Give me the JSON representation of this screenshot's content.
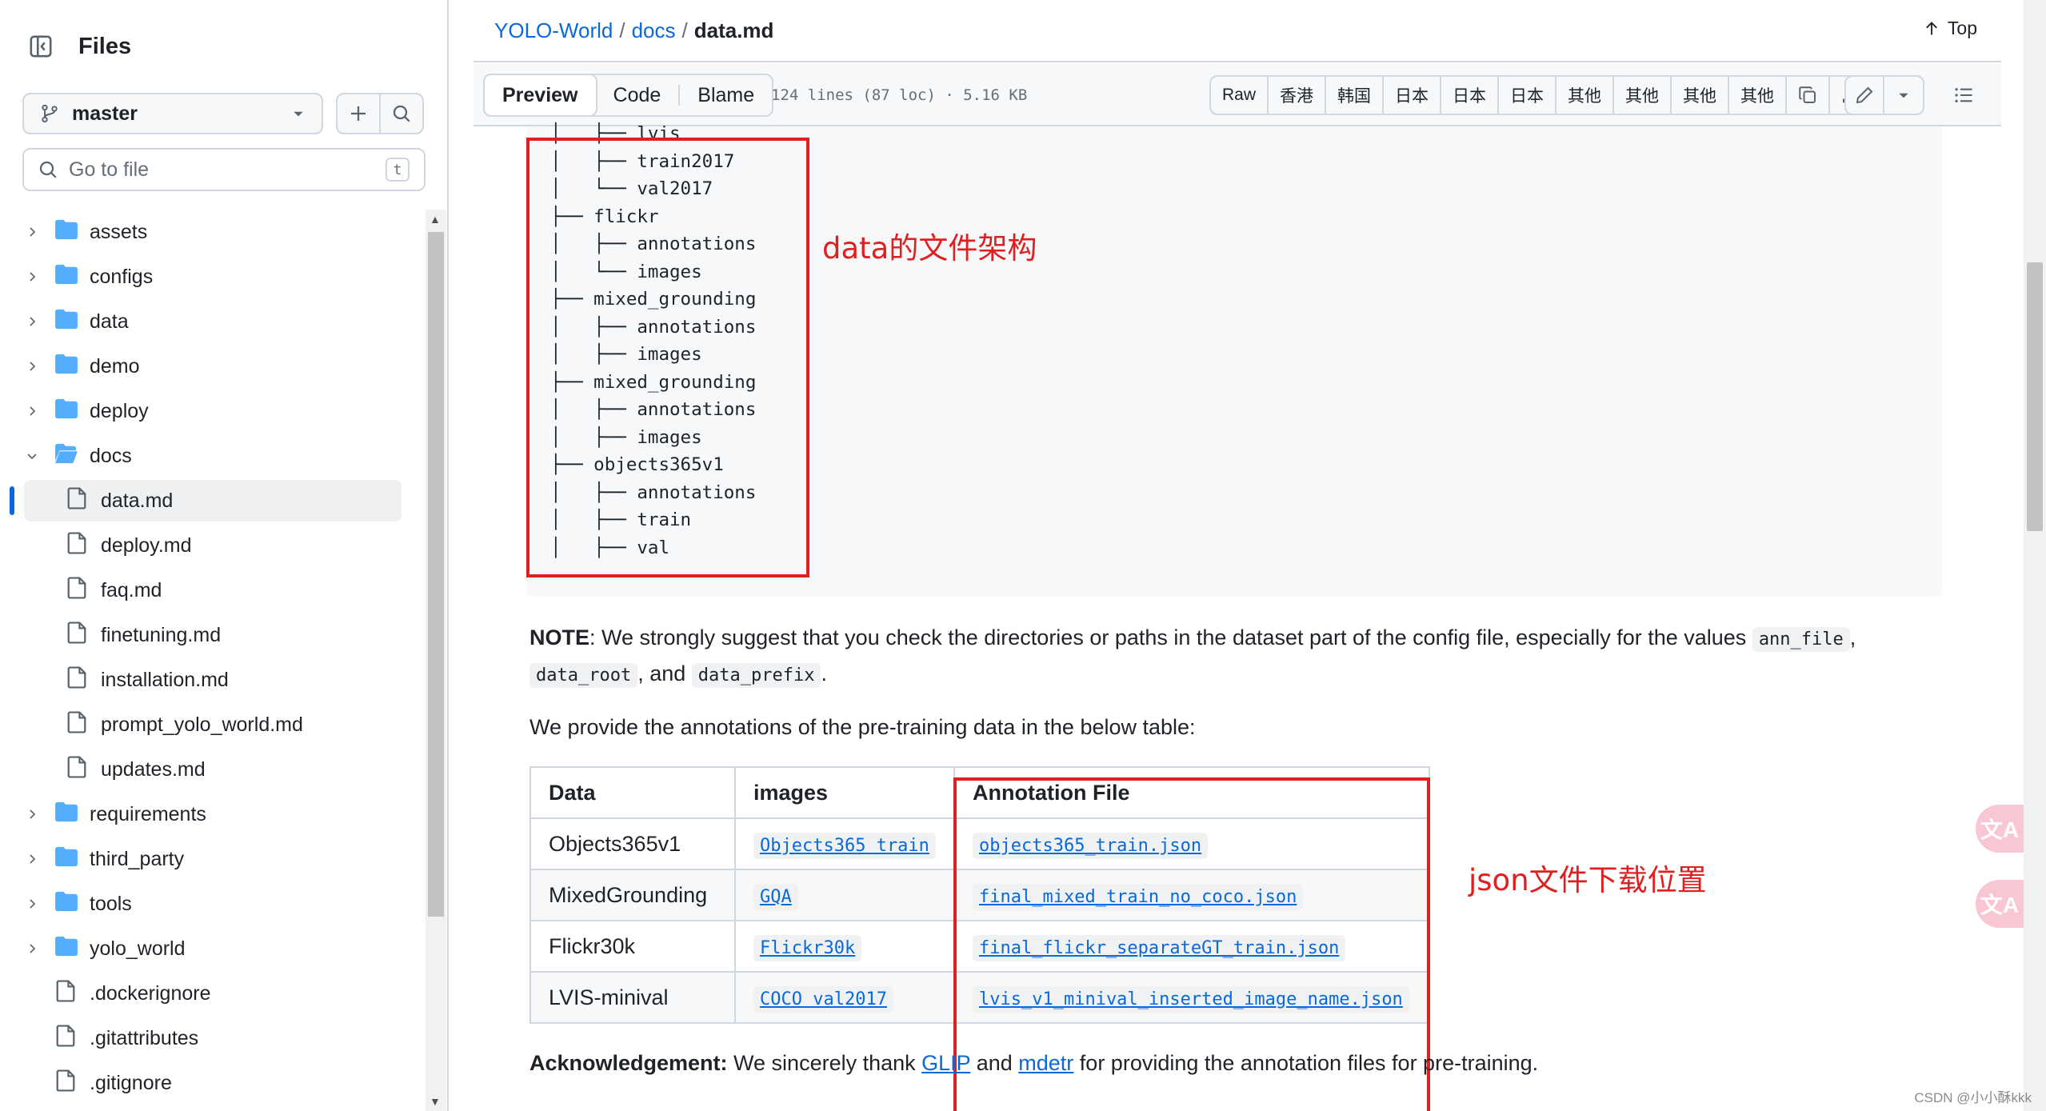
{
  "sidebar": {
    "title": "Files",
    "branch": "master",
    "goto_placeholder": "Go to file",
    "goto_shortcut": "t",
    "tree": [
      {
        "label": "assets",
        "type": "folder",
        "expanded": false
      },
      {
        "label": "configs",
        "type": "folder",
        "expanded": false
      },
      {
        "label": "data",
        "type": "folder",
        "expanded": false
      },
      {
        "label": "demo",
        "type": "folder",
        "expanded": false
      },
      {
        "label": "deploy",
        "type": "folder",
        "expanded": false
      },
      {
        "label": "docs",
        "type": "folder",
        "expanded": true
      },
      {
        "label": "data.md",
        "type": "file",
        "child": true,
        "selected": true
      },
      {
        "label": "deploy.md",
        "type": "file",
        "child": true
      },
      {
        "label": "faq.md",
        "type": "file",
        "child": true
      },
      {
        "label": "finetuning.md",
        "type": "file",
        "child": true
      },
      {
        "label": "installation.md",
        "type": "file",
        "child": true
      },
      {
        "label": "prompt_yolo_world.md",
        "type": "file",
        "child": true
      },
      {
        "label": "updates.md",
        "type": "file",
        "child": true
      },
      {
        "label": "requirements",
        "type": "folder",
        "expanded": false
      },
      {
        "label": "third_party",
        "type": "folder",
        "expanded": false
      },
      {
        "label": "tools",
        "type": "folder",
        "expanded": false
      },
      {
        "label": "yolo_world",
        "type": "folder",
        "expanded": false
      },
      {
        "label": ".dockerignore",
        "type": "file"
      },
      {
        "label": ".gitattributes",
        "type": "file"
      },
      {
        "label": ".gitignore",
        "type": "file"
      }
    ]
  },
  "breadcrumb": {
    "repo": "YOLO-World",
    "sep": "/",
    "dir": "docs",
    "file": "data.md"
  },
  "top_label": "Top",
  "filebar": {
    "tabs": [
      "Preview",
      "Code",
      "Blame"
    ],
    "loc": "124 lines (87 loc) · 5.16 KB",
    "toolbar": [
      "Raw",
      "香港",
      "韩国",
      "日本",
      "日本",
      "日本",
      "其他",
      "其他",
      "其他",
      "其他"
    ]
  },
  "code_tree": "│   ├── lvis\n│   ├── train2017\n│   └── val2017\n├── flickr\n│   ├── annotations\n│   └── images\n├── mixed_grounding\n│   ├── annotations\n│   ├── images\n├── mixed_grounding\n│   ├── annotations\n│   ├── images\n├── objects365v1\n│   ├── annotations\n│   ├── train\n│   ├── val",
  "annotations": {
    "data_arch": "data的文件架构",
    "json_loc": "json文件下载位置"
  },
  "note": {
    "label": "NOTE",
    "text1": ": We strongly suggest that you check the directories or paths in the dataset part of the config file, especially for the values ",
    "code1": "ann_file",
    "text2": ",",
    "code2": "data_root",
    "text3": ", and ",
    "code3": "data_prefix",
    "text4": "."
  },
  "provide_text": "We provide the annotations of the pre-training data in the below table:",
  "table": {
    "headers": [
      "Data",
      "images",
      "Annotation File"
    ],
    "rows": [
      [
        "Objects365v1",
        "Objects365 train",
        "objects365_train.json"
      ],
      [
        "MixedGrounding",
        "GQA",
        "final_mixed_train_no_coco.json"
      ],
      [
        "Flickr30k",
        "Flickr30k",
        "final_flickr_separateGT_train.json"
      ],
      [
        "LVIS-minival",
        "COCO val2017",
        "lvis_v1_minival_inserted_image_name.json"
      ]
    ]
  },
  "ack": {
    "label": "Acknowledgement:",
    "text1": " We sincerely thank ",
    "link1": "GLIP",
    "text2": " and ",
    "link2": "mdetr",
    "text3": " for providing the annotation files for pre-training."
  },
  "translate_glyph": "文A",
  "watermark": "CSDN @小小酥kkk"
}
